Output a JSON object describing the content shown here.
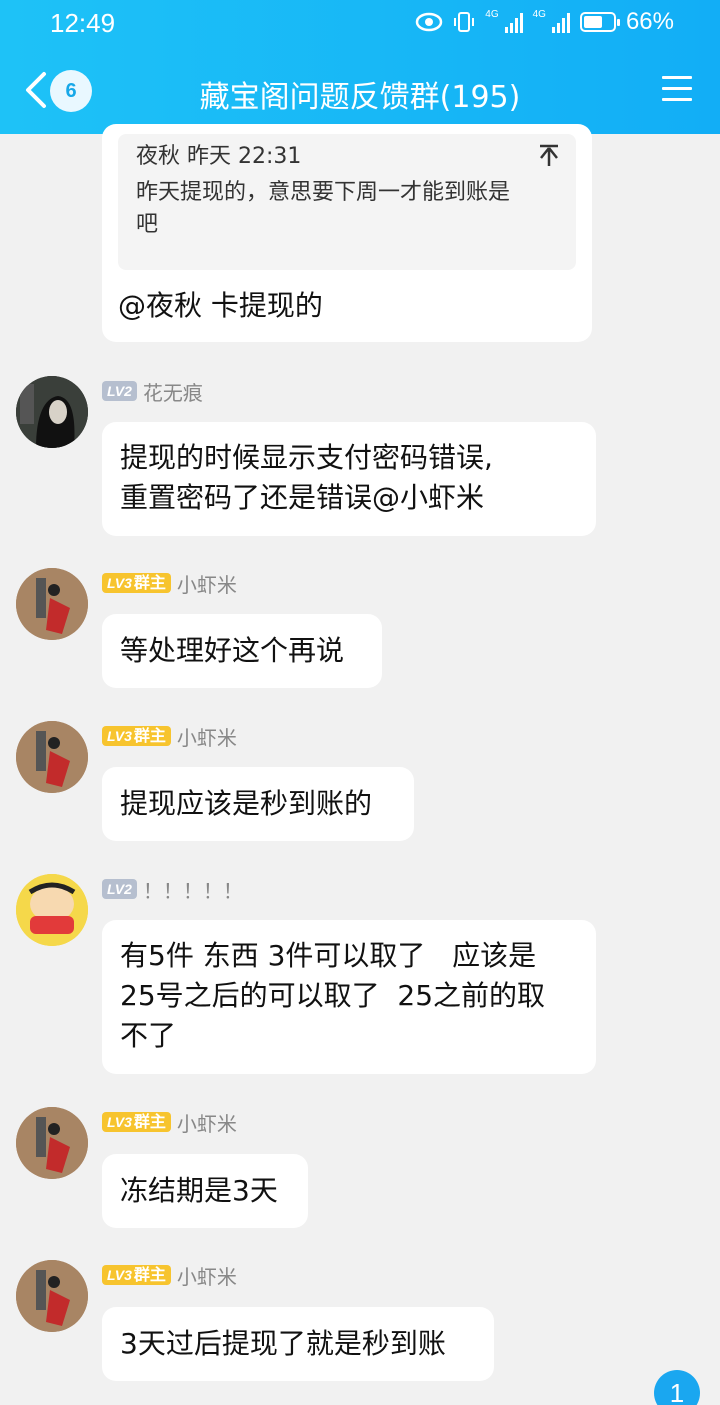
{
  "status_bar": {
    "time": "12:49",
    "network_a": "4G",
    "network_b": "4G",
    "battery": "66%",
    "battery_level": 0.66
  },
  "header": {
    "back_badge": "6",
    "title": "藏宝阁问题反馈群(195)"
  },
  "quote": {
    "author_time": "夜秋 昨天 22:31",
    "text_line1": "昨天提现的，意思要下周一才能到账是",
    "text_line2": "吧"
  },
  "messages": [
    {
      "text": "@夜秋 卡提现的"
    },
    {
      "level": "LV2",
      "name": "花无痕",
      "line1": "提现的时候显示支付密码错误,",
      "line2": "重置密码了还是错误@小虾米"
    },
    {
      "level": "LV3",
      "role": "群主",
      "name": "小虾米",
      "line1": "等处理好这个再说"
    },
    {
      "level": "LV3",
      "role": "群主",
      "name": "小虾米",
      "line1": "提现应该是秒到账的"
    },
    {
      "level": "LV2",
      "name": "！！！！！",
      "line1": "有5件 东西 3件可以取了   应该是",
      "line2": "25号之后的可以取了  25之前的取",
      "line3": "不了"
    },
    {
      "level": "LV3",
      "role": "群主",
      "name": "小虾米",
      "line1": "冻结期是3天"
    },
    {
      "level": "LV3",
      "role": "群主",
      "name": "小虾米",
      "line1": "3天过后提现了就是秒到账"
    }
  ],
  "fab": {
    "count": "1"
  },
  "colors": {
    "header": "#1ec2f7",
    "bubble": "#ffffff",
    "background": "#f1f1f1",
    "lv_gold": "#f7c42e",
    "lv_gray": "#b6bfcf"
  }
}
